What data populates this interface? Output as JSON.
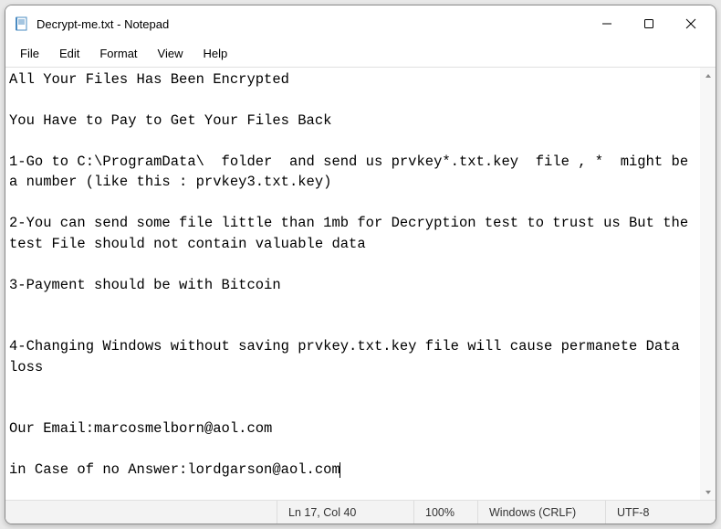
{
  "window": {
    "title": "Decrypt-me.txt - Notepad"
  },
  "menu": {
    "file": "File",
    "edit": "Edit",
    "format": "Format",
    "view": "View",
    "help": "Help"
  },
  "document": {
    "body": "All Your Files Has Been Encrypted\n\nYou Have to Pay to Get Your Files Back\n\n1-Go to C:\\ProgramData\\  folder  and send us prvkey*.txt.key  file , *  might be a number (like this : prvkey3.txt.key)\n\n2-You can send some file little than 1mb for Decryption test to trust us But the test File should not contain valuable data\n\n3-Payment should be with Bitcoin\n\n\n4-Changing Windows without saving prvkey.txt.key file will cause permanete Data loss\n\n\nOur Email:marcosmelborn@aol.com\n\nin Case of no Answer:lordgarson@aol.com"
  },
  "statusbar": {
    "position": "Ln 17, Col 40",
    "zoom": "100%",
    "line_ending": "Windows (CRLF)",
    "encoding": "UTF-8"
  }
}
